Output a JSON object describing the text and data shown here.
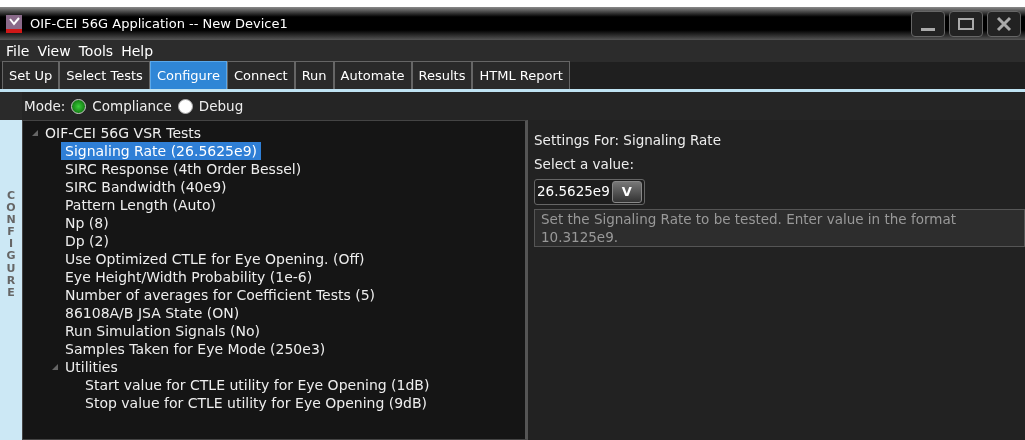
{
  "window": {
    "title": "OIF-CEI 56G Application -- New Device1"
  },
  "menu": [
    "File",
    "View",
    "Tools",
    "Help"
  ],
  "tabs": [
    {
      "label": "Set Up",
      "selected": false
    },
    {
      "label": "Select Tests",
      "selected": false
    },
    {
      "label": "Configure",
      "selected": true
    },
    {
      "label": "Connect",
      "selected": false
    },
    {
      "label": "Run",
      "selected": false
    },
    {
      "label": "Automate",
      "selected": false
    },
    {
      "label": "Results",
      "selected": false
    },
    {
      "label": "HTML Report",
      "selected": false
    }
  ],
  "mode": {
    "label": "Mode:",
    "options": [
      {
        "label": "Compliance",
        "selected": true
      },
      {
        "label": "Debug",
        "selected": false
      }
    ]
  },
  "side_label": "CONFIGURE",
  "tree": [
    {
      "label": "OIF-CEI 56G VSR Tests",
      "expanded": true,
      "selected": false,
      "children": [
        {
          "label": "Signaling Rate (26.5625e9)",
          "selected": true
        },
        {
          "label": "SIRC Response (4th Order Bessel)",
          "selected": false
        },
        {
          "label": "SIRC Bandwidth (40e9)",
          "selected": false
        },
        {
          "label": "Pattern Length (Auto)",
          "selected": false
        },
        {
          "label": "Np (8)",
          "selected": false
        },
        {
          "label": "Dp (2)",
          "selected": false
        },
        {
          "label": "Use Optimized CTLE for Eye Opening. (Off)",
          "selected": false
        },
        {
          "label": "Eye Height/Width Probability (1e-6)",
          "selected": false
        },
        {
          "label": "Number of averages for Coefficient Tests (5)",
          "selected": false
        },
        {
          "label": "86108A/B JSA State (ON)",
          "selected": false
        },
        {
          "label": "Run Simulation Signals (No)",
          "selected": false
        },
        {
          "label": "Samples Taken for Eye Mode (250e3)",
          "selected": false
        },
        {
          "label": "Utilities",
          "expanded": true,
          "selected": false,
          "children": [
            {
              "label": "Start value for CTLE utility for Eye Opening (1dB)",
              "selected": false
            },
            {
              "label": "Stop value for CTLE utility for Eye Opening (9dB)",
              "selected": false
            }
          ]
        }
      ]
    }
  ],
  "settings": {
    "title": "Settings For: Signaling Rate",
    "prompt": "Select a value:",
    "value": "26.5625e9",
    "dropdown_glyph": "V",
    "description": "Set the Signaling Rate to be tested. Enter value in the format 10.3125e9."
  }
}
